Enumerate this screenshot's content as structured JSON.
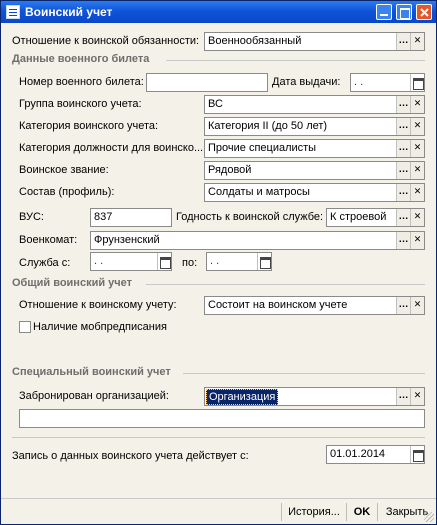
{
  "window": {
    "title": "Воинский учет"
  },
  "relation": {
    "label": "Отношение к воинской обязанности:",
    "value": "Военнообязанный"
  },
  "military_id": {
    "section_title": "Данные военного билета",
    "number_label": "Номер военного билета:",
    "number_value": "",
    "issue_date_label": "Дата выдачи:",
    "issue_date_value": " .  .",
    "group_label": "Группа воинского учета:",
    "group_value": "ВС",
    "category_label": "Категория воинского учета:",
    "category_value": "Категория II (до 50 лет)",
    "position_category_label": "Категория должности для воинско...",
    "position_category_value": "Прочие специалисты",
    "rank_label": "Воинское звание:",
    "rank_value": "Рядовой",
    "composition_label": "Состав (профиль):",
    "composition_value": "Солдаты и матросы",
    "vus_label": "ВУС:",
    "vus_value": "837",
    "fitness_label": "Годность к воинской службе:",
    "fitness_value": "К строевой",
    "commissariat_label": "Военкомат:",
    "commissariat_value": "Фрунзенский",
    "service_from_label": "Служба с:",
    "service_from_value": " .  .",
    "service_to_label": "по:",
    "service_to_value": " .  ."
  },
  "general": {
    "section_title": "Общий воинский учет",
    "relation_label": "Отношение к воинскому учету:",
    "relation_value": "Состоит на воинском учете",
    "mobilization_label": "Наличие мобпредписания",
    "mobilization_checked": false
  },
  "special": {
    "section_title": "Специальный воинский учет",
    "reserved_label": "Забронирован организацией:",
    "reserved_value": "Организация",
    "extra_value": ""
  },
  "record": {
    "label": "Запись о данных воинского учета действует с:",
    "value": "01.01.2014"
  },
  "bottom_bar": {
    "history_label": "История...",
    "ok_label": "OK",
    "close_label": "Закрыть"
  }
}
